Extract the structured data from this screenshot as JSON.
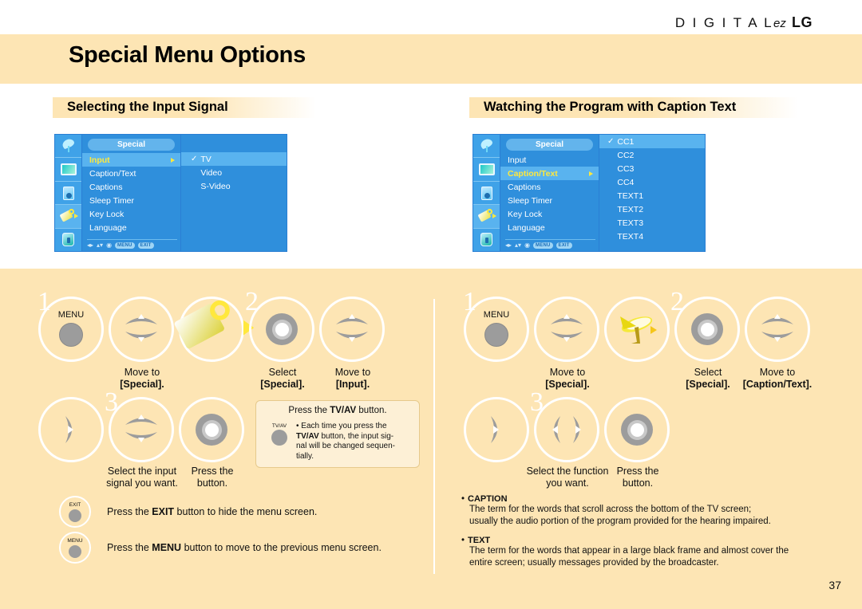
{
  "header": {
    "logo_digital": "D I G I T A L",
    "logo_ez": "ez",
    "logo_lg": "LG",
    "title": "Special Menu Options"
  },
  "sections": [
    {
      "heading": "Selecting the Input Signal"
    },
    {
      "heading": "Watching the Program with Caption Text"
    }
  ],
  "osd_left": {
    "title": "Special",
    "side_icons": [
      "dish-icon",
      "tv-icon",
      "speaker-icon",
      "brush-icon",
      "lock-icon"
    ],
    "items": [
      {
        "label": "Input",
        "highlighted": true,
        "caret": true
      },
      {
        "label": "Caption/Text",
        "highlighted": false,
        "caret": false
      },
      {
        "label": "Captions",
        "highlighted": false,
        "caret": false
      },
      {
        "label": "Sleep Timer",
        "highlighted": false,
        "caret": false
      },
      {
        "label": "Key Lock",
        "highlighted": false,
        "caret": false
      },
      {
        "label": "Language",
        "highlighted": false,
        "caret": false
      }
    ],
    "options": [
      {
        "label": "TV",
        "checked": true
      },
      {
        "label": "Video",
        "checked": false
      },
      {
        "label": "S-Video",
        "checked": false
      }
    ],
    "nav": {
      "lr": "◂▸",
      "ud": "▴▾",
      "ok": "◉",
      "menu": "MENU",
      "exit": "EXIT"
    }
  },
  "osd_right": {
    "title": "Special",
    "side_icons": [
      "dish-icon",
      "tv-icon",
      "speaker-icon",
      "brush-icon",
      "lock-icon"
    ],
    "items": [
      {
        "label": "Input",
        "highlighted": false,
        "caret": false
      },
      {
        "label": "Caption/Text",
        "highlighted": true,
        "caret": true
      },
      {
        "label": "Captions",
        "highlighted": false,
        "caret": false
      },
      {
        "label": "Sleep Timer",
        "highlighted": false,
        "caret": false
      },
      {
        "label": "Key Lock",
        "highlighted": false,
        "caret": false
      },
      {
        "label": "Language",
        "highlighted": false,
        "caret": false
      }
    ],
    "options": [
      {
        "label": "CC1",
        "checked": true
      },
      {
        "label": "CC2",
        "checked": false
      },
      {
        "label": "CC3",
        "checked": false
      },
      {
        "label": "CC4",
        "checked": false
      },
      {
        "label": "TEXT1",
        "checked": false
      },
      {
        "label": "TEXT2",
        "checked": false
      },
      {
        "label": "TEXT3",
        "checked": false
      },
      {
        "label": "TEXT4",
        "checked": false
      }
    ],
    "nav": {
      "lr": "◂▸",
      "ud": "▴▾",
      "ok": "◉",
      "menu": "MENU",
      "exit": "EXIT"
    }
  },
  "left_steps": {
    "step1_num": "1",
    "step2_num": "2",
    "step3_num": "3",
    "menu_label": "MENU",
    "cap_move_special_1": "Move to",
    "cap_move_special_2": "[Special].",
    "cap_select_1": "Select",
    "cap_select_2": "[Special].",
    "cap_move_input_1": "Move to",
    "cap_move_input_2": "[Input].",
    "cap_select_input_1": "Select the input",
    "cap_select_input_2": "signal you want.",
    "cap_press_1": "Press the",
    "cap_press_2": "button."
  },
  "right_steps": {
    "step1_num": "1",
    "step2_num": "2",
    "step3_num": "3",
    "menu_label": "MENU",
    "cap_move_special_1": "Move to",
    "cap_move_special_2": "[Special].",
    "cap_select_1": "Select",
    "cap_select_2": "[Special].",
    "cap_move_ct_1": "Move to",
    "cap_move_ct_2": "[Caption/Text].",
    "cap_select_fn_1": "Select the function",
    "cap_select_fn_2": "you want.",
    "cap_press_1": "Press the",
    "cap_press_2": "button."
  },
  "note": {
    "title_pre": "Press the ",
    "title_bold": "TV/AV",
    "title_post": " button.",
    "button_label": "TV/AV",
    "body_line1_pre": "• Each time you press the",
    "body_bold": "TV/AV",
    "body_line2_post": " button, the input sig-",
    "body_line3": "nal will be changed sequen-",
    "body_line4": "tially."
  },
  "instructions": [
    {
      "button_label": "EXIT",
      "text_pre": "Press the ",
      "text_bold": "EXIT",
      "text_post": " button to hide the menu screen."
    },
    {
      "button_label": "MENU",
      "text_pre": "Press the ",
      "text_bold": "MENU",
      "text_post": " button to move to the previous menu screen."
    }
  ],
  "glossary": [
    {
      "term": "CAPTION",
      "line1": "The term for the words that scroll across the bottom of the TV screen;",
      "line2": "usually the audio portion of the program provided for the hearing impaired."
    },
    {
      "term": "TEXT",
      "line1": "The term for the words that appear in a large black frame and almost cover the",
      "line2": "entire screen; usually messages provided by the broadcaster."
    }
  ],
  "page_number": "37"
}
